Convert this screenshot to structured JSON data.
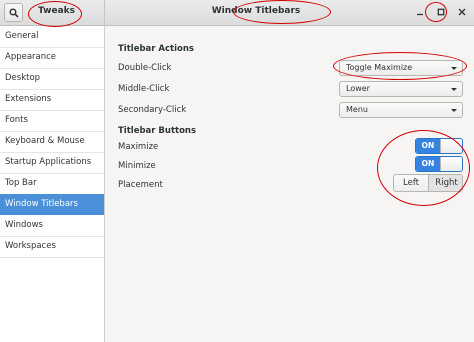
{
  "header": {
    "app_title": "Tweaks",
    "window_title": "Window Titlebars",
    "icons": [
      "search-icon",
      "minimize-icon",
      "maximize-icon",
      "close-icon"
    ]
  },
  "sidebar": {
    "items": [
      {
        "label": "General"
      },
      {
        "label": "Appearance"
      },
      {
        "label": "Desktop"
      },
      {
        "label": "Extensions"
      },
      {
        "label": "Fonts"
      },
      {
        "label": "Keyboard & Mouse"
      },
      {
        "label": "Startup Applications"
      },
      {
        "label": "Top Bar"
      },
      {
        "label": "Window Titlebars"
      },
      {
        "label": "Windows"
      },
      {
        "label": "Workspaces"
      }
    ],
    "active": "Window Titlebars"
  },
  "main": {
    "titlebar_actions": {
      "heading": "Titlebar Actions",
      "double_click": {
        "label": "Double-Click",
        "value": "Toggle Maximize"
      },
      "middle_click": {
        "label": "Middle-Click",
        "value": "Lower"
      },
      "secondary_click": {
        "label": "Secondary-Click",
        "value": "Menu"
      }
    },
    "titlebar_buttons": {
      "heading": "Titlebar Buttons",
      "maximize": {
        "label": "Maximize",
        "state": "ON"
      },
      "minimize": {
        "label": "Minimize",
        "state": "ON"
      },
      "placement": {
        "label": "Placement",
        "left": "Left",
        "right": "Right",
        "selected": "Right"
      }
    }
  },
  "colors": {
    "accent": "#4a90d9",
    "switch_on": "#3584e4",
    "annotation": "#d40000"
  }
}
